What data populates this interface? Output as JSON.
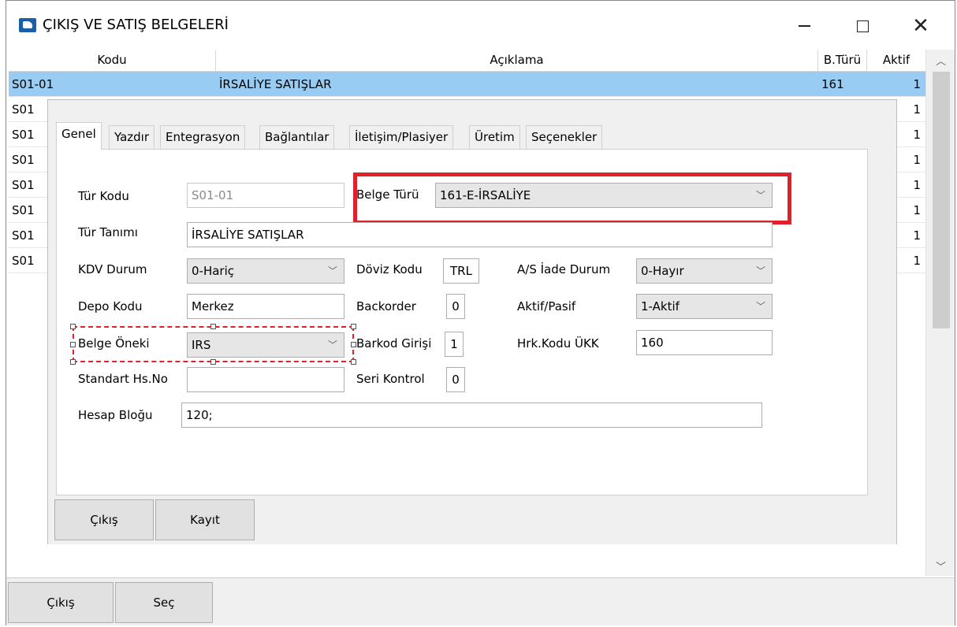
{
  "window": {
    "title": "ÇIKIŞ VE SATIŞ BELGELERİ",
    "minimize": "—",
    "close": "✕"
  },
  "grid": {
    "columns": [
      "Kodu",
      "Açıklama",
      "B.Türü",
      "Aktif"
    ],
    "rows": [
      {
        "kodu": "S01-01",
        "aciklama": "İRSALİYE SATIŞLAR",
        "bturu": "161",
        "aktif": "1"
      },
      {
        "kodu": "S01",
        "aciklama": "",
        "bturu": "",
        "aktif": "1"
      },
      {
        "kodu": "S01",
        "aciklama": "",
        "bturu": "",
        "aktif": "1"
      },
      {
        "kodu": "S01",
        "aciklama": "",
        "bturu": "",
        "aktif": "1"
      },
      {
        "kodu": "S01",
        "aciklama": "",
        "bturu": "",
        "aktif": "1"
      },
      {
        "kodu": "S01",
        "aciklama": "",
        "bturu": "",
        "aktif": "1"
      },
      {
        "kodu": "S01",
        "aciklama": "",
        "bturu": "",
        "aktif": "1"
      },
      {
        "kodu": "S01",
        "aciklama": "",
        "bturu": "",
        "aktif": "1"
      }
    ],
    "selected_row": 0
  },
  "tabs": [
    "Genel",
    "Yazdır",
    "Entegrasyon",
    "Bağlantılar",
    "İletişim/Plasiyer",
    "Üretim",
    "Seçenekler"
  ],
  "active_tab": "Genel",
  "form": {
    "tur_kodu_label": "Tür Kodu",
    "tur_kodu_value": "S01-01",
    "belge_turu_label": "Belge Türü",
    "belge_turu_value": "161-E-İRSALİYE",
    "tur_tanimi_label": "Tür Tanımı",
    "tur_tanimi_value": "İRSALİYE SATIŞLAR",
    "kdv_durum_label": "KDV Durum",
    "kdv_durum_value": "0-Hariç",
    "doviz_kodu_label": "Döviz Kodu",
    "doviz_kodu_value": "TRL",
    "as_iade_label": "A/S İade Durum",
    "as_iade_value": "0-Hayır",
    "depo_kodu_label": "Depo Kodu",
    "depo_kodu_value": "Merkez",
    "backorder_label": "Backorder",
    "backorder_value": "0",
    "aktif_pasif_label": "Aktif/Pasif",
    "aktif_pasif_value": "1-Aktif",
    "belge_oneki_label": "Belge Öneki",
    "belge_oneki_value": "IRS",
    "barkod_girisi_label": "Barkod Girişi",
    "barkod_girisi_value": "1",
    "hrk_kodu_label": "Hrk.Kodu ÜKK",
    "hrk_kodu_value": "160",
    "standart_hs_label": "Standart Hs.No",
    "standart_hs_value": "",
    "seri_kontrol_label": "Seri Kontrol",
    "seri_kontrol_value": "0",
    "hesap_blogu_label": "Hesap Bloğu",
    "hesap_blogu_value": "120;"
  },
  "dialog_buttons": {
    "exit": "Çıkış",
    "save": "Kayıt"
  },
  "bottom_buttons": {
    "exit": "Çıkış",
    "select": "Seç"
  },
  "icons": {
    "dropdown": "chevron-down-icon",
    "scroll_up": "chevron-up-icon",
    "scroll_down": "chevron-down-icon"
  },
  "colors": {
    "selection": "#99ccf3",
    "highlight": "#e0202a"
  }
}
